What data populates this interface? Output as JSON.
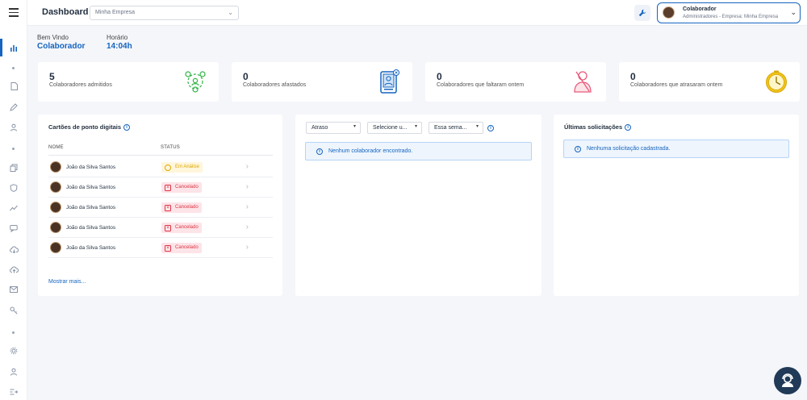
{
  "topbar": {
    "title": "Dashboard",
    "company_select": {
      "value": "Minha Empresa"
    },
    "user": {
      "name": "Colaborador",
      "role": "Administradores - Empresa: Minha Empresa"
    }
  },
  "greeting": {
    "welcome_label": "Bem Vindo",
    "welcome_name": "Colaborador",
    "time_label": "Horário",
    "time_value": "14:04h"
  },
  "stats": [
    {
      "value": "5",
      "label": "Colaboradores admitidos",
      "icon": "team-icon",
      "color": "#2fb344"
    },
    {
      "value": "0",
      "label": "Colaboradores afastados",
      "icon": "id-card-icon",
      "color": "#1565c0"
    },
    {
      "value": "0",
      "label": "Colaboradores que faltaram ontem",
      "icon": "absent-person-icon",
      "color": "#e85a7a"
    },
    {
      "value": "0",
      "label": "Colaboradores que atrasaram ontem",
      "icon": "clock-icon",
      "color": "#f0c419"
    }
  ],
  "timecards": {
    "title": "Cartões de ponto digitais",
    "col_name": "NOME",
    "col_status": "STATUS",
    "rows": [
      {
        "name": "João da Silva Santos",
        "status": "Em Análise",
        "type": "warn"
      },
      {
        "name": "João da Silva Santos",
        "status": "Cancelado",
        "type": "danger"
      },
      {
        "name": "João da Silva Santos",
        "status": "Cancelado",
        "type": "danger"
      },
      {
        "name": "João da Silva Santos",
        "status": "Cancelado",
        "type": "danger"
      },
      {
        "name": "João da Silva Santos",
        "status": "Cancelado",
        "type": "danger"
      }
    ],
    "more_link": "Mostrar mais..."
  },
  "filters": {
    "type": "Atraso",
    "unit": "Selecione u...",
    "period": "Essa sema...",
    "empty_message": "Nenhum colaborador encontrado."
  },
  "requests": {
    "title": "Últimas solicitações",
    "empty_message": "Nenhuma solicitação cadastrada."
  },
  "colors": {
    "primary": "#1565c0",
    "background": "#f5f6fa",
    "fab": "#213a57"
  }
}
